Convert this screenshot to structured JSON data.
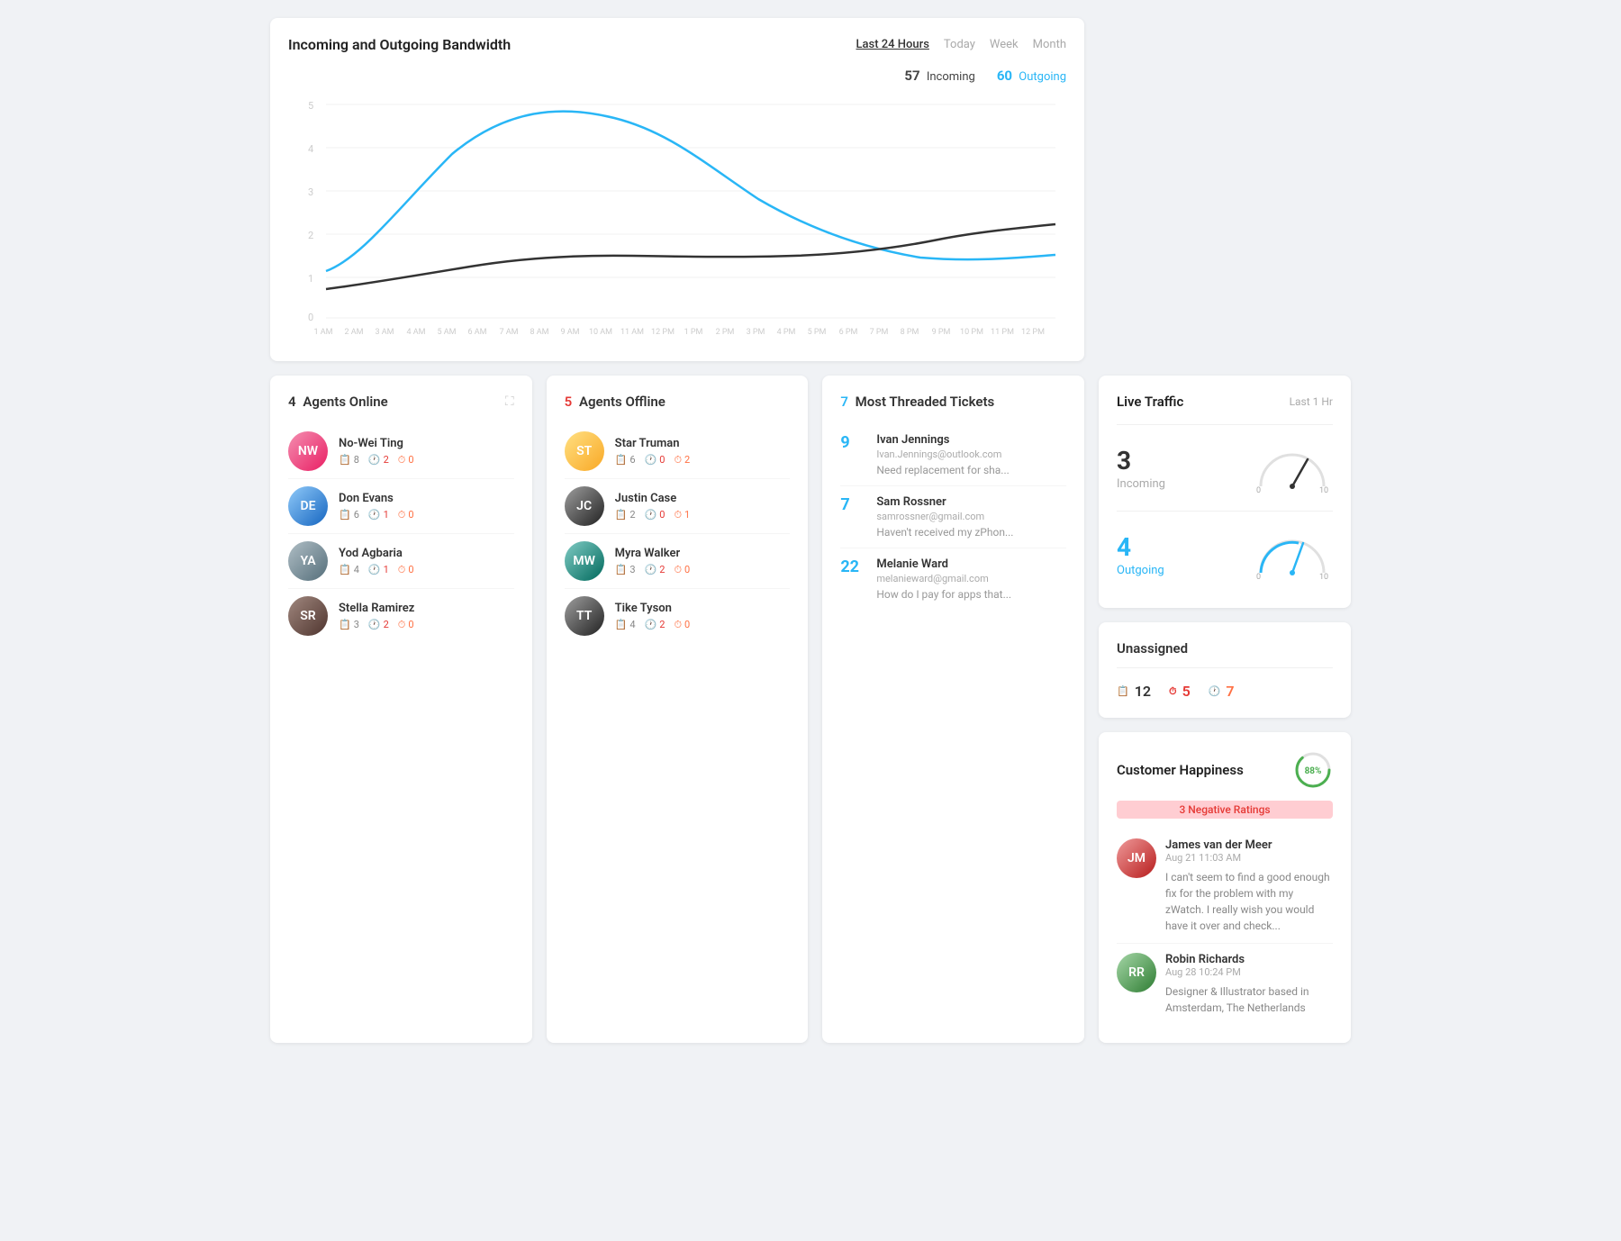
{
  "bandwidth": {
    "title": "Incoming and Outgoing Bandwidth",
    "filters": [
      "Last 24 Hours",
      "Today",
      "Week",
      "Month"
    ],
    "active_filter": "Last 24 Hours",
    "incoming_count": "57",
    "incoming_label": "Incoming",
    "outgoing_count": "60",
    "outgoing_label": "Outgoing",
    "y_labels": [
      "5",
      "4",
      "3",
      "2",
      "1",
      "0"
    ],
    "x_labels": [
      "1 AM",
      "2 AM",
      "3 AM",
      "4 AM",
      "5 AM",
      "6 AM",
      "7 AM",
      "8 AM",
      "9 AM",
      "10 AM",
      "11 AM",
      "12 PM",
      "1 PM",
      "2 PM",
      "3 PM",
      "4 PM",
      "5 PM",
      "6 PM",
      "7 PM",
      "8 PM",
      "9 PM",
      "10 PM",
      "11 PM",
      "12 PM"
    ]
  },
  "live_traffic": {
    "title": "Live Traffic",
    "subtitle": "Last 1 Hr",
    "incoming_value": "3",
    "incoming_label": "Incoming",
    "outgoing_value": "4",
    "outgoing_label": "Outgoing",
    "gauge_min": "0",
    "gauge_max": "10"
  },
  "unassigned": {
    "title": "Unassigned",
    "items": [
      {
        "icon": "📋",
        "value": "12",
        "color": "default"
      },
      {
        "icon": "⏱",
        "value": "5",
        "color": "red"
      },
      {
        "icon": "🕐",
        "value": "7",
        "color": "orange"
      }
    ]
  },
  "agents_online": {
    "title": "Agents Online",
    "count": "4",
    "agents": [
      {
        "name": "No-Wei Ting",
        "avatar": "NW",
        "color": "av-pink",
        "stats": {
          "tickets": "8",
          "urgent": "2",
          "overdue": "0"
        }
      },
      {
        "name": "Don Evans",
        "avatar": "DE",
        "color": "av-blue",
        "stats": {
          "tickets": "6",
          "urgent": "1",
          "overdue": "0"
        }
      },
      {
        "name": "Yod Agbaria",
        "avatar": "YA",
        "color": "av-gray",
        "stats": {
          "tickets": "4",
          "urgent": "1",
          "overdue": "0"
        }
      },
      {
        "name": "Stella Ramirez",
        "avatar": "SR",
        "color": "av-brown",
        "stats": {
          "tickets": "3",
          "urgent": "2",
          "overdue": "0"
        }
      }
    ]
  },
  "agents_offline": {
    "title": "Agents Offline",
    "count": "5",
    "agents": [
      {
        "name": "Star Truman",
        "avatar": "ST",
        "color": "av-blonde",
        "stats": {
          "tickets": "6",
          "urgent": "0",
          "overdue": "2"
        }
      },
      {
        "name": "Justin Case",
        "avatar": "JC",
        "color": "av-dark",
        "stats": {
          "tickets": "2",
          "urgent": "0",
          "overdue": "1"
        }
      },
      {
        "name": "Myra Walker",
        "avatar": "MW",
        "color": "av-teal",
        "stats": {
          "tickets": "3",
          "urgent": "2",
          "overdue": "0"
        }
      },
      {
        "name": "Tike Tyson",
        "avatar": "TT",
        "color": "av-dark",
        "stats": {
          "tickets": "4",
          "urgent": "2",
          "overdue": "0"
        }
      }
    ]
  },
  "tickets": {
    "title": "Most Threaded Tickets",
    "count": "7",
    "items": [
      {
        "num": "9",
        "name": "Ivan Jennings",
        "email": "Ivan.Jennings@outlook.com",
        "preview": "Need replacement for sha..."
      },
      {
        "num": "7",
        "name": "Sam Rossner",
        "email": "samrossner@gmail.com",
        "preview": "Haven't received my zPhon..."
      },
      {
        "num": "22",
        "name": "Melanie Ward",
        "email": "melanieward@gmail.com",
        "preview": "How do I pay for apps that..."
      }
    ]
  },
  "happiness": {
    "title": "Customer Happiness",
    "percentage": "88%",
    "negative_label": "3 Negative Ratings",
    "reviews": [
      {
        "name": "James van der Meer",
        "date": "Aug 21 11:03 AM",
        "avatar": "JM",
        "color": "av-red",
        "text": "I can't seem to find a good enough fix for the problem with my zWatch. I really wish you would have it over and check..."
      },
      {
        "name": "Robin Richards",
        "date": "Aug 28 10:24 PM",
        "avatar": "RR",
        "color": "av-green",
        "text": "Designer & Illustrator based in Amsterdam, The Netherlands"
      }
    ]
  }
}
